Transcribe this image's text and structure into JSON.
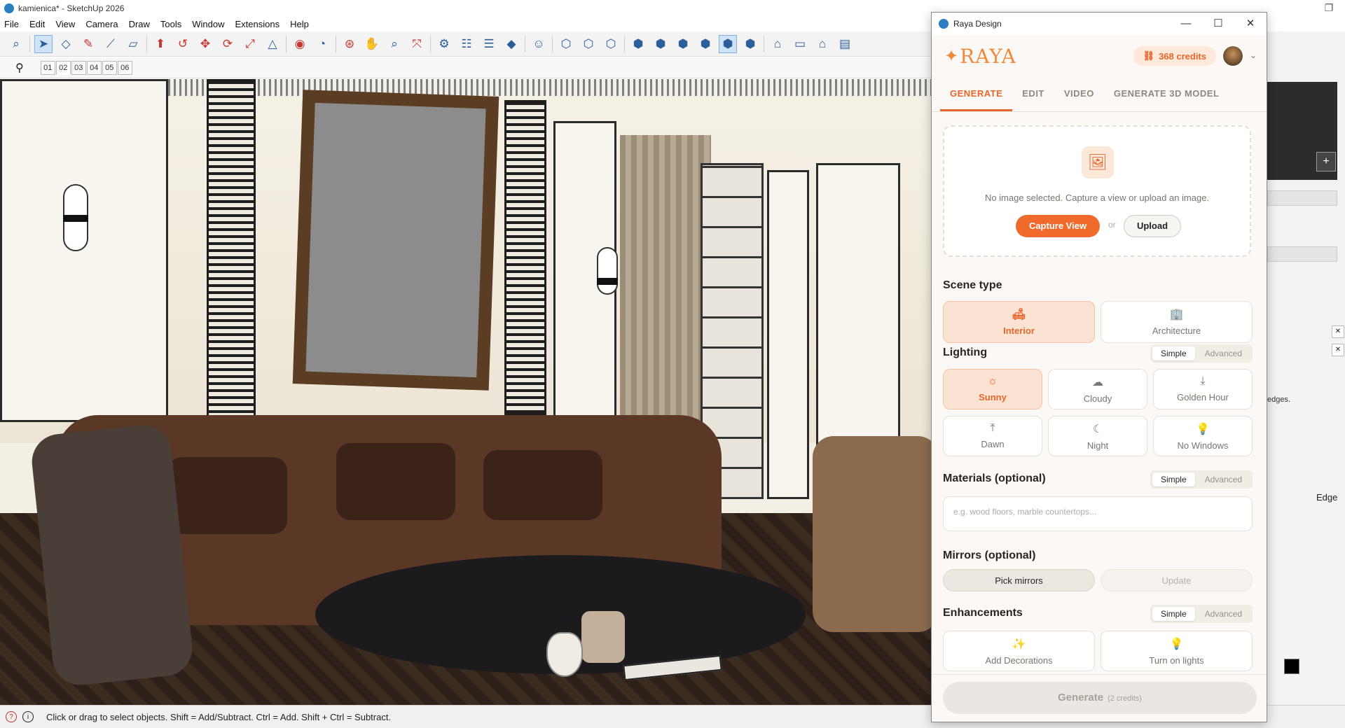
{
  "window": {
    "title": "kamienica* - SketchUp 2026"
  },
  "menu": [
    "File",
    "Edit",
    "View",
    "Camera",
    "Draw",
    "Tools",
    "Window",
    "Extensions",
    "Help"
  ],
  "scenes": {
    "tabs": [
      "01",
      "02",
      "03",
      "04",
      "05",
      "06"
    ],
    "active_index": 1
  },
  "status": {
    "message": "Click or drag to select objects. Shift = Add/Subtract. Ctrl = Add. Shift + Ctrl = Subtract."
  },
  "tray": {
    "edge_label": "Edge",
    "material_note": "edges."
  },
  "raya": {
    "window_title": "Raya Design",
    "logo": "RAYA",
    "credits": "368 credits",
    "tabs": [
      "GENERATE",
      "EDIT",
      "VIDEO",
      "GENERATE 3D MODEL"
    ],
    "active_tab": 0,
    "dropzone": {
      "message": "No image selected. Capture a view or upload an image.",
      "capture_label": "Capture View",
      "or_label": "or",
      "upload_label": "Upload"
    },
    "scene_type": {
      "title": "Scene type",
      "options": [
        {
          "label": "Interior",
          "icon": "sofa-icon",
          "selected": true
        },
        {
          "label": "Architecture",
          "icon": "building-icon",
          "selected": false
        }
      ]
    },
    "lighting": {
      "title": "Lighting",
      "mode": {
        "simple": "Simple",
        "advanced": "Advanced"
      },
      "options": [
        {
          "label": "Sunny",
          "icon": "sun-icon",
          "selected": true
        },
        {
          "label": "Cloudy",
          "icon": "cloud-icon",
          "selected": false
        },
        {
          "label": "Golden Hour",
          "icon": "sunset-icon",
          "selected": false
        },
        {
          "label": "Dawn",
          "icon": "sunrise-icon",
          "selected": false
        },
        {
          "label": "Night",
          "icon": "moon-icon",
          "selected": false
        },
        {
          "label": "No Windows",
          "icon": "bulb-icon",
          "selected": false
        }
      ]
    },
    "materials": {
      "title": "Materials (optional)",
      "mode": {
        "simple": "Simple",
        "advanced": "Advanced"
      },
      "placeholder": "e.g. wood floors, marble countertops..."
    },
    "mirrors": {
      "title": "Mirrors (optional)",
      "pick_label": "Pick mirrors",
      "update_label": "Update"
    },
    "enhancements": {
      "title": "Enhancements",
      "mode": {
        "simple": "Simple",
        "advanced": "Advanced"
      },
      "options": [
        {
          "label": "Add Decorations",
          "icon": "magic-wand-icon"
        },
        {
          "label": "Turn on lights",
          "icon": "bulb-icon"
        }
      ]
    },
    "generate": {
      "label": "Generate",
      "cost": "(2 credits)"
    }
  }
}
